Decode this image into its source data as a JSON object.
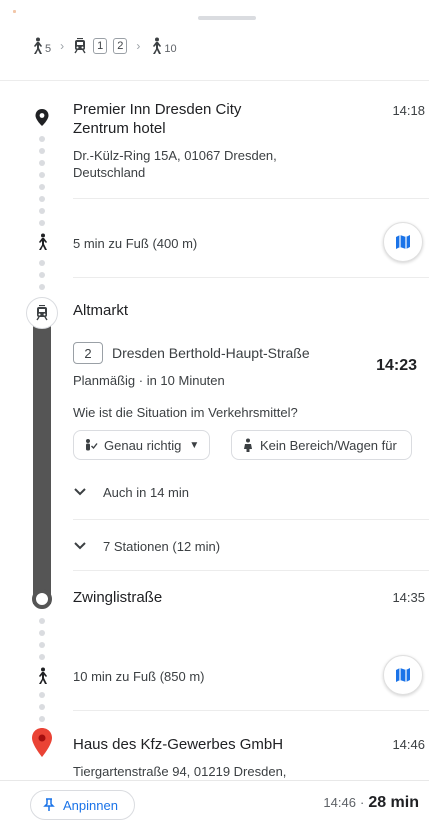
{
  "summary": {
    "walk1_minutes": "5",
    "tram_lines": [
      "1",
      "2"
    ],
    "walk2_minutes": "10"
  },
  "origin": {
    "name_line1": "Premier Inn Dresden City",
    "name_line2": "Zentrum hotel",
    "time": "14:18",
    "address_line1": "Dr.-Külz-Ring 15A, 01067 Dresden,",
    "address_line2": "Deutschland"
  },
  "walk1": {
    "label": "5 min zu Fuß (400 m)"
  },
  "tram": {
    "stop": "Altmarkt",
    "line": "2",
    "direction": "Dresden Berthold-Haupt-Straße",
    "time": "14:23",
    "schedule": "Planmäßig · in 10 Minuten",
    "question": "Wie ist die Situation im Verkehrsmittel?",
    "chip1": "Genau richtig",
    "chip2": "Kein Bereich/Wagen für",
    "also": "Auch in 14 min",
    "stations": "7 Stationen (12 min)"
  },
  "arrival_stop": {
    "name": "Zwinglistraße",
    "time": "14:35"
  },
  "walk2": {
    "label": "10 min zu Fuß (850 m)"
  },
  "destination": {
    "name": "Haus des Kfz-Gewerbes GmbH",
    "time": "14:46",
    "address_line1": "Tiergartenstraße 94, 01219 Dresden,"
  },
  "footer": {
    "pin_label": "Anpinnen",
    "arrival_time": "14:46",
    "separator": "·",
    "duration": "28 min"
  },
  "colors": {
    "accent": "#1a73e8",
    "rail": "#555555",
    "destination_pin": "#ea4335"
  },
  "icons": [
    "walk-icon",
    "tram-icon",
    "location-pin-icon",
    "map-icon",
    "occupancy-icon",
    "person-icon",
    "chevron-down-icon",
    "pin-icon"
  ]
}
